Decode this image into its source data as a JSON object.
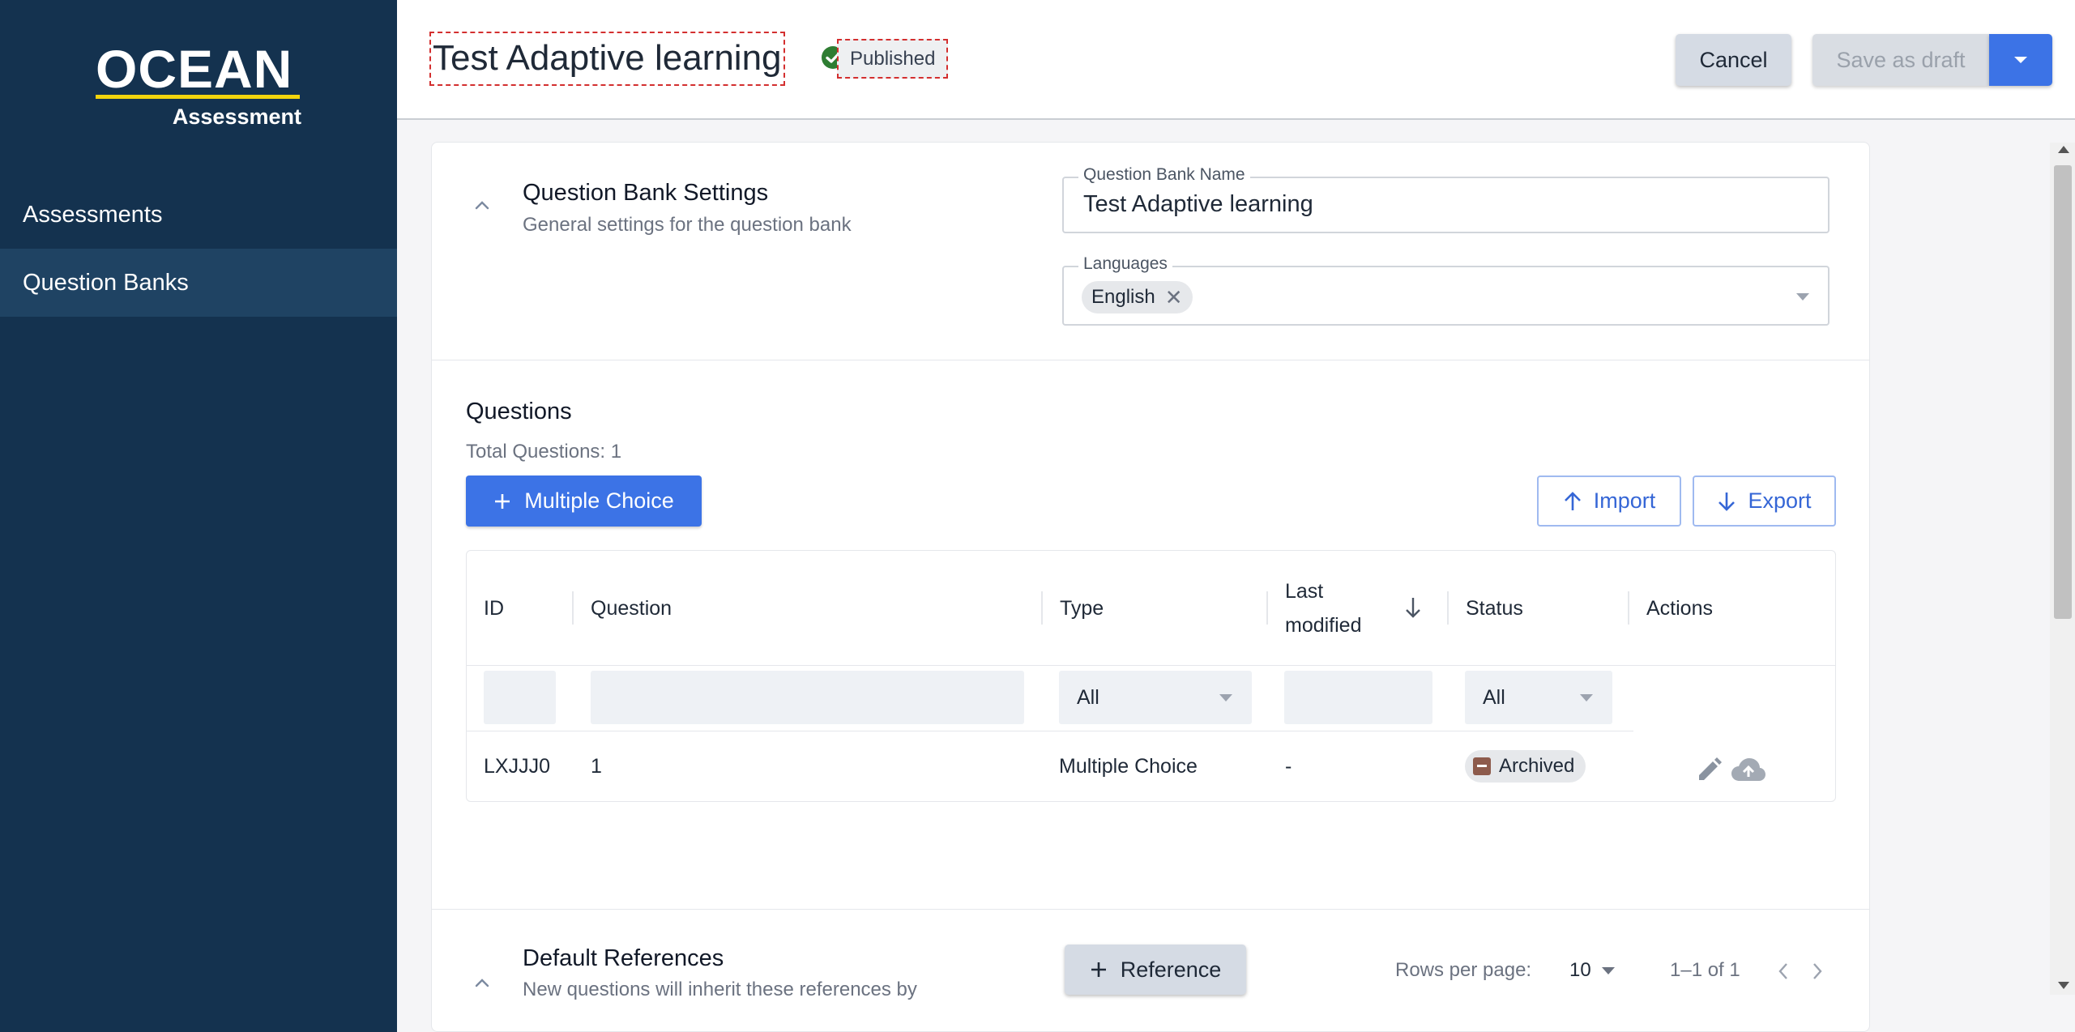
{
  "sidebar": {
    "logo": {
      "word": "OCEAN",
      "sub": "Assessment"
    },
    "items": [
      {
        "label": "Assessments"
      },
      {
        "label": "Question Banks"
      }
    ]
  },
  "header": {
    "title": "Test Adaptive learning",
    "status": "Published",
    "cancel_label": "Cancel",
    "save_label": "Save as draft"
  },
  "settings": {
    "title": "Question Bank Settings",
    "subtitle": "General settings for the question bank",
    "name_label": "Question Bank Name",
    "name_value": "Test Adaptive learning",
    "languages_label": "Languages",
    "languages": [
      "English"
    ]
  },
  "questions": {
    "title": "Questions",
    "total": "Total Questions: 1",
    "add_label": "Multiple Choice",
    "import_label": "Import",
    "export_label": "Export",
    "columns": {
      "id": "ID",
      "question": "Question",
      "type": "Type",
      "last_modified_1": "Last",
      "last_modified_2": "modified",
      "status": "Status",
      "actions": "Actions"
    },
    "filters": {
      "type": "All",
      "status": "All"
    },
    "rows": [
      {
        "id": "LXJJJ0",
        "question": "1",
        "type": "Multiple Choice",
        "last_modified": "-",
        "status": "Archived"
      }
    ],
    "pagination": {
      "rows_per_page_label": "Rows per page:",
      "rows_per_page": "10",
      "range": "1–1 of 1"
    }
  },
  "references": {
    "title": "Default References",
    "subtitle": "New questions will inherit these references by",
    "add_label": "Reference"
  },
  "colors": {
    "sidebar": "#14324f",
    "accent": "#3c73e6",
    "logo_bar": "#f2d40d",
    "published": "#2e7d32"
  }
}
